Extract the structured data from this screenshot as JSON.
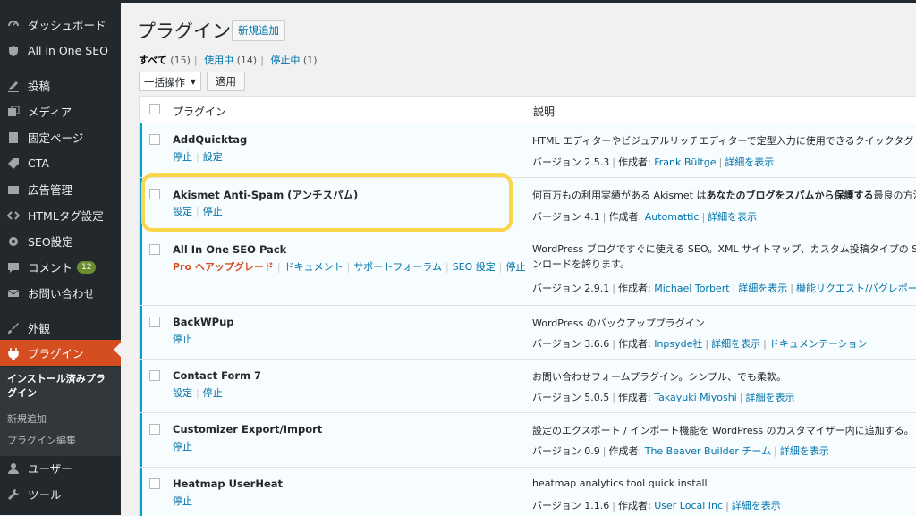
{
  "sidebar": {
    "items": [
      {
        "label": "ダッシュボード",
        "icon": "dashboard-icon"
      },
      {
        "label": "All in One SEO",
        "icon": "shield-icon"
      },
      {
        "label": "投稿",
        "icon": "pin-icon"
      },
      {
        "label": "メディア",
        "icon": "media-icon"
      },
      {
        "label": "固定ページ",
        "icon": "page-icon"
      },
      {
        "label": "CTA",
        "icon": "tag-icon"
      },
      {
        "label": "広告管理",
        "icon": "ad-icon"
      },
      {
        "label": "HTMLタグ設定",
        "icon": "code-icon"
      },
      {
        "label": "SEO設定",
        "icon": "gear-icon"
      },
      {
        "label": "コメント",
        "icon": "comment-icon",
        "count": "12"
      },
      {
        "label": "お問い合わせ",
        "icon": "mail-icon"
      },
      {
        "label": "外観",
        "icon": "brush-icon"
      },
      {
        "label": "プラグイン",
        "icon": "plugin-icon"
      },
      {
        "label": "ユーザー",
        "icon": "user-icon"
      },
      {
        "label": "ツール",
        "icon": "wrench-icon"
      }
    ],
    "submenu": {
      "installed": "インストール済みプラグイン",
      "add_new": "新規追加",
      "editor": "プラグイン編集"
    }
  },
  "page": {
    "title": "プラグイン",
    "add_new": "新規追加"
  },
  "filters": {
    "all": "すべて",
    "all_count": "(15)",
    "active": "使用中",
    "active_count": "(14)",
    "inactive": "停止中",
    "inactive_count": "(1)",
    "sep": "|"
  },
  "bulk": {
    "select": "一括操作",
    "apply": "適用"
  },
  "table": {
    "col_plugin": "プラグイン",
    "col_desc": "説明",
    "version_label": "バージョン",
    "author_label": "作成者:",
    "rows": [
      {
        "name": "AddQuicktag",
        "actions": [
          "停止",
          "設定"
        ],
        "desc": "HTML エディターやビジュアルリッチエディターで定型入力に使用できるクイックタグ",
        "version": "2.5.3",
        "author": "Frank Bültge",
        "links": [
          "詳細を表示"
        ]
      },
      {
        "name": "Akismet Anti-Spam (アンチスパム)",
        "actions": [
          "設定",
          "停止"
        ],
        "desc_pre": "何百万もの利用実績がある Akismet は",
        "desc_bold": "あなたのブログをスパムから保護する",
        "desc_post": "最良の方法",
        "version": "4.1",
        "author": "Automattic",
        "links": [
          "詳細を表示"
        ]
      },
      {
        "name": "All In One SEO Pack",
        "actions_upgrade": "Pro へアップグレード",
        "actions": [
          "ドキュメント",
          "サポートフォーラム",
          "SEO 設定",
          "停止"
        ],
        "desc": "WordPress ブログですぐに使える SEO。XML サイトマップ、カスタム投稿タイプの SEO 統合…ンロードを誇ります。",
        "desc_line1": "WordPress ブログですぐに使える SEO。XML サイトマップ、カスタム投稿タイプの SEO",
        "desc_line2": "ンロードを誇ります。",
        "version": "2.9.1",
        "author": "Michael Torbert",
        "links": [
          "詳細を表示",
          "機能リクエスト/バグレポート"
        ]
      },
      {
        "name": "BackWPup",
        "actions": [
          "停止"
        ],
        "desc": "WordPress のバックアッププラグイン",
        "version": "3.6.6",
        "author": "Inpsyde社",
        "links": [
          "詳細を表示",
          "ドキュメンテーション"
        ]
      },
      {
        "name": "Contact Form 7",
        "actions": [
          "設定",
          "停止"
        ],
        "desc": "お問い合わせフォームプラグイン。シンプル、でも柔軟。",
        "version": "5.0.5",
        "author": "Takayuki Miyoshi",
        "links": [
          "詳細を表示"
        ]
      },
      {
        "name": "Customizer Export/Import",
        "actions": [
          "停止"
        ],
        "desc": "設定のエクスポート / インポート機能を WordPress のカスタマイザー内に追加する。",
        "version": "0.9",
        "author": "The Beaver Builder チーム",
        "links": [
          "詳細を表示"
        ]
      },
      {
        "name": "Heatmap UserHeat",
        "actions": [
          "停止"
        ],
        "desc": "heatmap analytics tool quick install",
        "version": "1.1.6",
        "author": "User Local Inc",
        "links": [
          "詳細を表示"
        ]
      }
    ]
  },
  "colors": {
    "sidebar_bg": "#23282d",
    "current_menu": "#d54e21",
    "link": "#0073aa",
    "active_border": "#00a0d2",
    "highlight": "#f9d64a"
  }
}
